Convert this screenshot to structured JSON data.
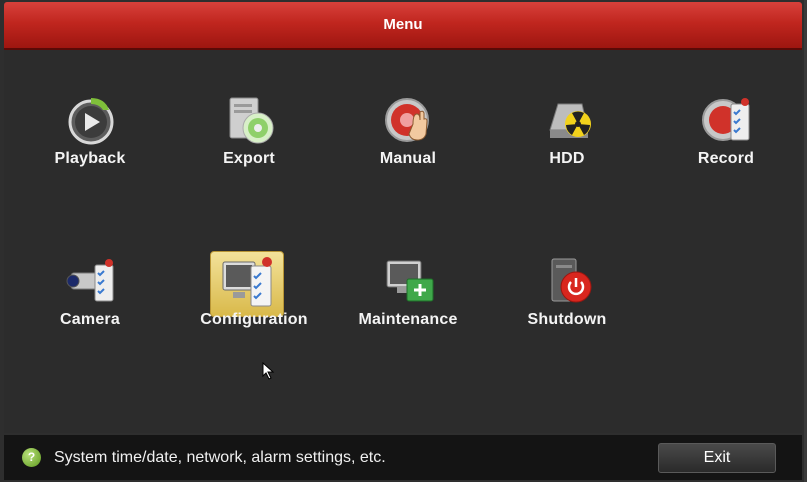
{
  "window": {
    "title": "Menu"
  },
  "menu_items": [
    {
      "label": "Playback",
      "icon": "playback-icon"
    },
    {
      "label": "Export",
      "icon": "export-icon"
    },
    {
      "label": "Manual",
      "icon": "manual-record-icon"
    },
    {
      "label": "HDD",
      "icon": "hdd-icon"
    },
    {
      "label": "Record",
      "icon": "record-schedule-icon"
    },
    {
      "label": "Camera",
      "icon": "camera-icon"
    },
    {
      "label": "Configuration",
      "icon": "configuration-icon",
      "selected": true
    },
    {
      "label": "Maintenance",
      "icon": "maintenance-icon"
    },
    {
      "label": "Shutdown",
      "icon": "shutdown-icon"
    }
  ],
  "status": {
    "hint": "System time/date, network, alarm settings, etc.",
    "help_icon": "question-icon"
  },
  "buttons": {
    "exit_label": "Exit"
  },
  "colors": {
    "title_bar": "#c0261f",
    "background": "#2c2c2c",
    "status_bar": "#141414",
    "selected_tile": "#e6c866"
  }
}
